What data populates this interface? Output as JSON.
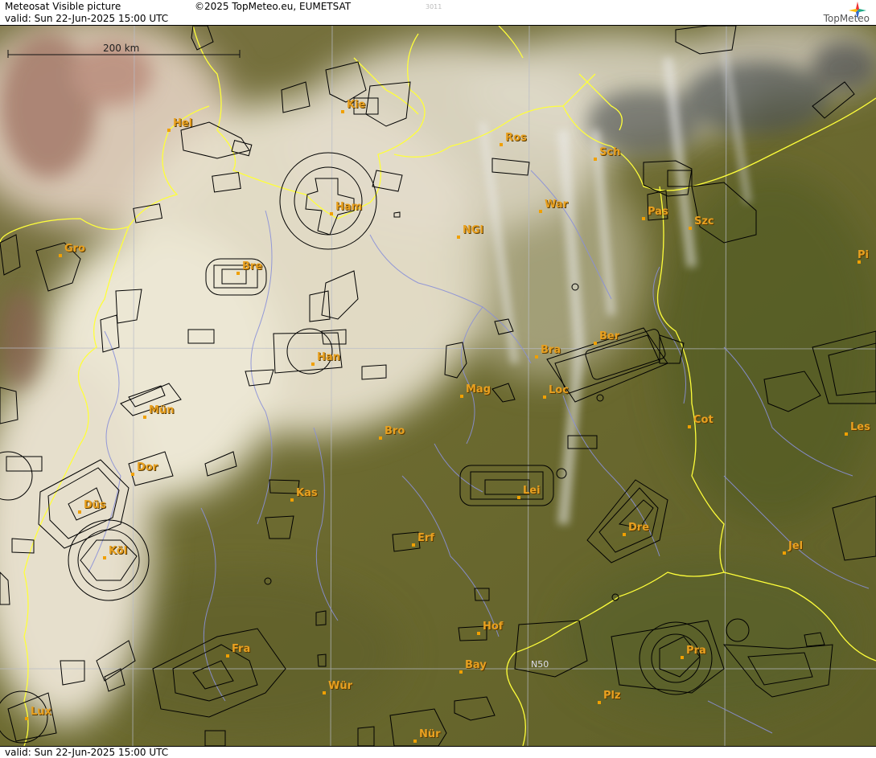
{
  "header": {
    "title": "Meteosat Visible picture",
    "valid_text": "valid:  Sun  22-Jun-2025  15:00 UTC",
    "copyright": "©2025 TopMeteo.eu, EUMETSAT",
    "code": "3011",
    "logo_text": "TopMeteo"
  },
  "footer": {
    "valid_text": "valid:  Sun  22-Jun-2025  15:00 UTC"
  },
  "scale": {
    "label": "200 km"
  },
  "grid_label": "N50",
  "colors": {
    "land": "#6f6a35",
    "cloud": "#e9e2cf",
    "coast": "#ffff3a",
    "river": "#8a90d8",
    "city_dot": "#f0a000",
    "city_label": "#e8a020"
  },
  "cities": [
    {
      "id": "hel",
      "label": "Hel"
    },
    {
      "id": "kie",
      "label": "Kie"
    },
    {
      "id": "ros",
      "label": "Ros"
    },
    {
      "id": "sch",
      "label": "Sch"
    },
    {
      "id": "ham",
      "label": "Ham"
    },
    {
      "id": "war",
      "label": "War"
    },
    {
      "id": "pas",
      "label": "Pas"
    },
    {
      "id": "szc",
      "label": "Szc"
    },
    {
      "id": "ngl",
      "label": "NGl"
    },
    {
      "id": "gro",
      "label": "Gro"
    },
    {
      "id": "bre",
      "label": "Bre"
    },
    {
      "id": "pi",
      "label": "Pi"
    },
    {
      "id": "ber",
      "label": "Ber"
    },
    {
      "id": "bra",
      "label": "Bra"
    },
    {
      "id": "han",
      "label": "Han"
    },
    {
      "id": "mag",
      "label": "Mag"
    },
    {
      "id": "loc",
      "label": "Loc"
    },
    {
      "id": "mun",
      "label": "Mün"
    },
    {
      "id": "cot",
      "label": "Cot"
    },
    {
      "id": "les",
      "label": "Les"
    },
    {
      "id": "bro",
      "label": "Bro"
    },
    {
      "id": "dor",
      "label": "Dor"
    },
    {
      "id": "kas",
      "label": "Kas"
    },
    {
      "id": "lei",
      "label": "Lei"
    },
    {
      "id": "dus",
      "label": "Düs"
    },
    {
      "id": "dre",
      "label": "Dre"
    },
    {
      "id": "erf",
      "label": "Erf"
    },
    {
      "id": "kol",
      "label": "Köl"
    },
    {
      "id": "jel",
      "label": "Jel"
    },
    {
      "id": "hof",
      "label": "Hof"
    },
    {
      "id": "fra",
      "label": "Fra"
    },
    {
      "id": "pra",
      "label": "Pra"
    },
    {
      "id": "bay",
      "label": "Bay"
    },
    {
      "id": "wur",
      "label": "Wür"
    },
    {
      "id": "plz",
      "label": "Plz"
    },
    {
      "id": "lux",
      "label": "Lux"
    },
    {
      "id": "nur",
      "label": "Nür"
    }
  ]
}
